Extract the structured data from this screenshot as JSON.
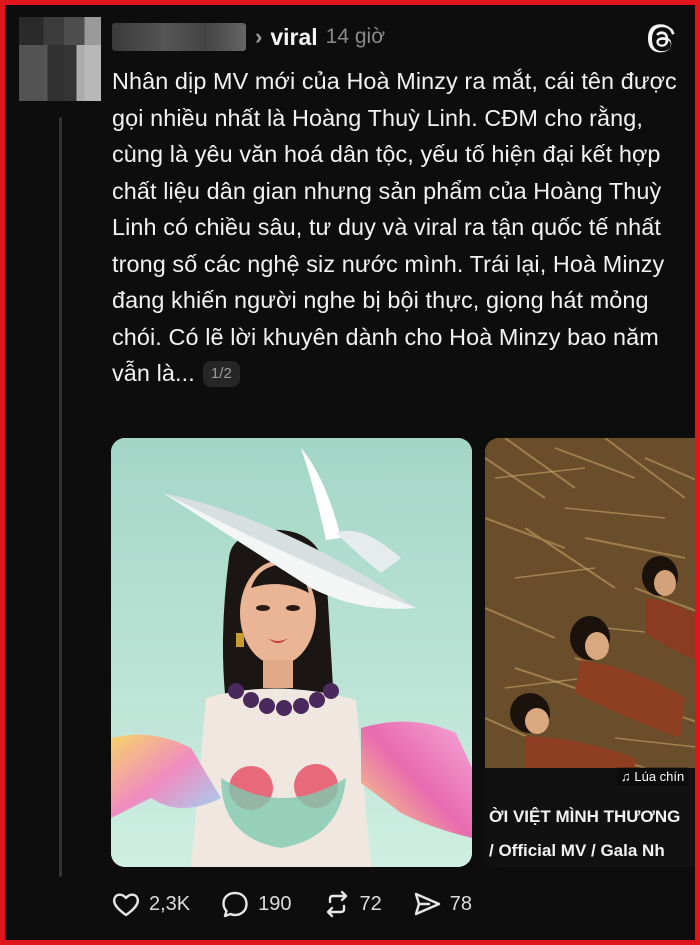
{
  "post": {
    "handle": "viral",
    "time": "14 giờ",
    "text": "Nhân dịp MV mới của Hoà Minzy ra mắt, cái tên được gọi nhiều nhất là Hoàng Thuỳ Linh. CĐM cho rằng, cùng là yêu văn hoá dân tộc, yếu tố hiện đại kết hợp chất liệu dân gian nhưng sản phẩm của Hoàng Thuỳ Linh có chiều sâu, tư duy và viral ra tận quốc tế nhất trong số các nghệ siz nước mình. Trái lại, Hoà Minzy đang khiến người nghe bị bội thực, giọng hát mỏng chói. Có lẽ lời khuyên dành cho Hoà Minzy bao năm vẫn là...",
    "page_indicator": "1/2"
  },
  "media": {
    "second_caption_line1": "ỜI VIỆT MÌNH THƯƠNG",
    "second_caption_line2": "/ Official MV / Gala Nh",
    "music_tag": "♫ Lúa chín"
  },
  "actions": {
    "likes": "2,3K",
    "comments": "190",
    "reposts": "72",
    "shares": "78"
  },
  "icons": [
    "threads-logo-icon",
    "heart-icon",
    "comment-icon",
    "repost-icon",
    "share-icon",
    "chevron-right-icon"
  ],
  "colors": {
    "frame_border": "#e0141b",
    "background": "#0d0d0d",
    "text": "#f2f2f2",
    "muted": "#8a8a8a"
  }
}
